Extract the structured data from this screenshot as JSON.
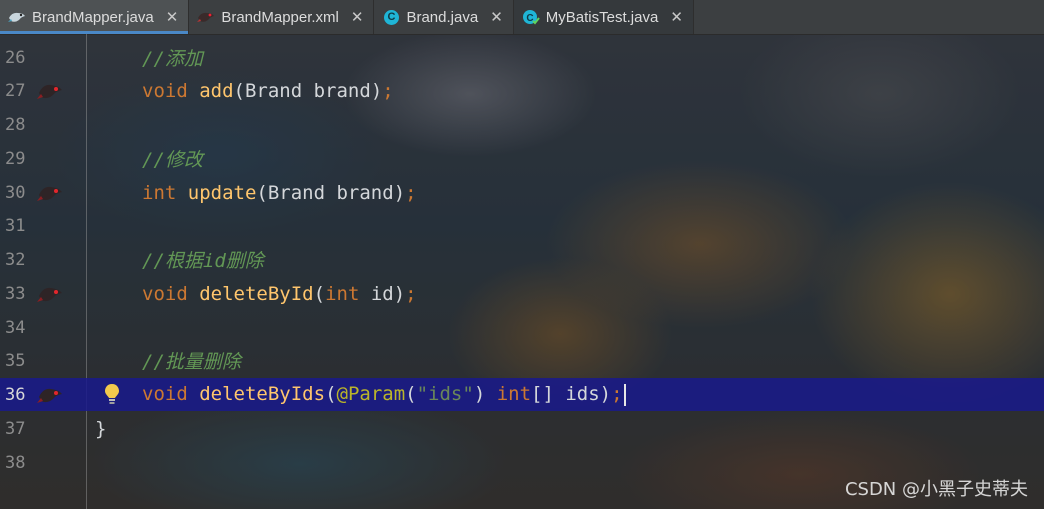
{
  "tabs": [
    {
      "label": "BrandMapper.java",
      "icon": "mybatis-bird-icon",
      "active": true
    },
    {
      "label": "BrandMapper.xml",
      "icon": "mybatis-bird-icon",
      "active": false
    },
    {
      "label": "Brand.java",
      "icon": "class-c-icon",
      "active": false
    },
    {
      "label": "MyBatisTest.java",
      "icon": "test-class-icon",
      "active": false
    }
  ],
  "close_glyph": "✕",
  "editor": {
    "current_line": 36,
    "lines": [
      {
        "num": "26",
        "comment": "//添加"
      },
      {
        "num": "27",
        "kw": "void",
        "fn": "add",
        "rest": "(Brand brand)",
        "semi": ";"
      },
      {
        "num": "28"
      },
      {
        "num": "29",
        "comment": "//修改"
      },
      {
        "num": "30",
        "kw": "int",
        "fn": "update",
        "rest": "(Brand brand)",
        "semi": ";"
      },
      {
        "num": "31"
      },
      {
        "num": "32",
        "comment": "//根据id删除"
      },
      {
        "num": "33",
        "kw": "void",
        "fn": "deleteById",
        "paren": "(",
        "kw2": "int",
        "rest": " id)",
        "semi": ";"
      },
      {
        "num": "34"
      },
      {
        "num": "35",
        "comment": "//批量删除"
      },
      {
        "num": "36",
        "kw": "void",
        "fn": "deleteByIds",
        "paren": "(",
        "ann": "@Param",
        "paren2": "(",
        "str": "\"ids\"",
        "paren3": ") ",
        "kw2": "int",
        "rest": "[] ids)",
        "semi": ";"
      },
      {
        "num": "37",
        "brace": "}"
      },
      {
        "num": "38"
      }
    ]
  },
  "watermark": "CSDN @小黑子史蒂夫",
  "colors": {
    "keyword": "#cc7832",
    "function": "#ffc66d",
    "comment": "#629755",
    "annotation": "#bbb529",
    "string": "#6a8759",
    "current_line": "#19198c"
  }
}
